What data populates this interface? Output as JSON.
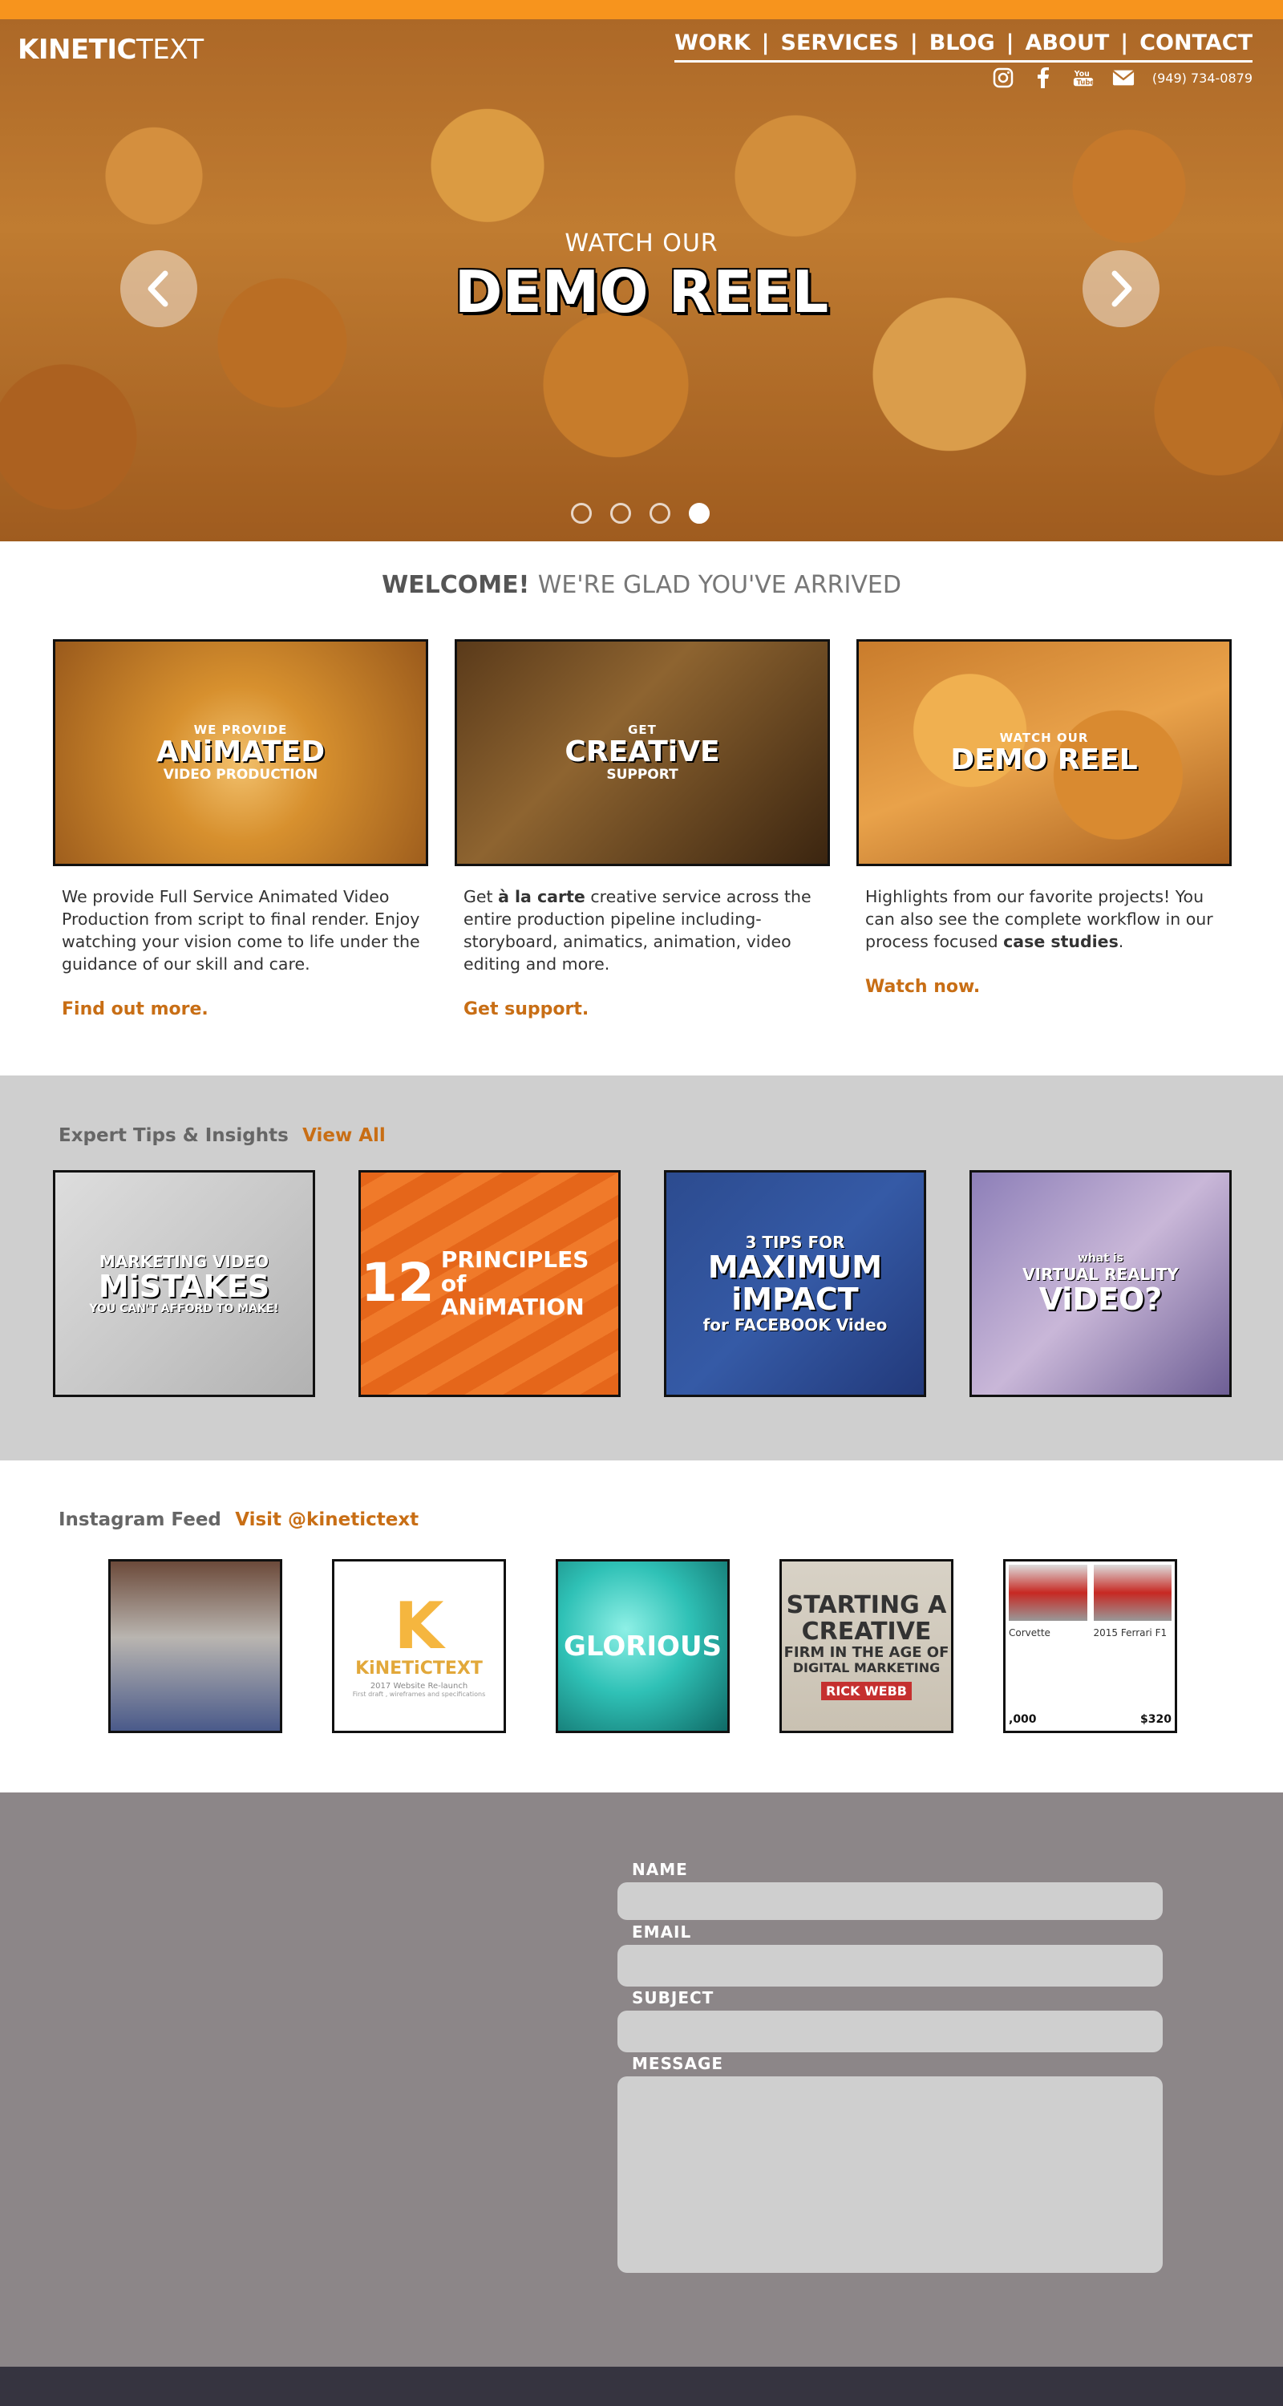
{
  "brand": {
    "logo_bold": "KINETIC",
    "logo_light": "TEXT",
    "accent": "#f7941d",
    "link_color": "#c86e15"
  },
  "nav": {
    "items": [
      "WORK",
      "SERVICES",
      "BLOG",
      "ABOUT",
      "CONTACT"
    ],
    "separator": "|",
    "phone": "(949) 734-0879",
    "social_icons": [
      "instagram-icon",
      "facebook-icon",
      "youtube-icon",
      "email-icon"
    ]
  },
  "hero": {
    "kicker": "WATCH OUR",
    "title": "DEMO REEL",
    "slides_total": 4,
    "active_slide": 4
  },
  "welcome": {
    "strong": "WELCOME!",
    "light": "WE'RE GLAD YOU'VE ARRIVED"
  },
  "cards": [
    {
      "img_top": "WE PROVIDE",
      "img_big": "ANiMATED",
      "img_sub": "VIDEO PRODUCTION",
      "text": "We provide Full Service Animated Video Production from script to final render. Enjoy watching your vision come to life under the guidance of our skill and care.",
      "link": "Find out more."
    },
    {
      "img_top": "GET",
      "img_big": "CREATiVE",
      "img_sub": "SUPPORT",
      "text_before": "Get ",
      "text_bold": "à la carte",
      "text_after": " creative service across the entire production pipeline including- storyboard, animatics, animation, video editing and more.",
      "link": "Get support."
    },
    {
      "img_top": "WATCH OUR",
      "img_big": "DEMO REEL",
      "img_sub": "",
      "text_before": "Highlights from our favorite projects! You can also see the complete workflow in our process focused ",
      "text_bold": "case studies",
      "text_after": ".",
      "link": "Watch now."
    }
  ],
  "tips": {
    "heading": "Expert Tips & Insights",
    "view_all": "View All",
    "tiles": [
      {
        "l1": "MARKETING VIDEO",
        "l2": "MiSTAKES",
        "l3": "YOU CAN'T AFFORD TO MAKE!"
      },
      {
        "num": "12",
        "w1": "PRINCIPLES of",
        "w2": "ANiMATION"
      },
      {
        "l1": "3 TIPS FOR",
        "l2a": "MAXIMUM",
        "l2b": "iMPACT",
        "l3": "for FACEBOOK Video"
      },
      {
        "l1": "what is",
        "l1b": "VIRTUAL REALITY",
        "l2": "ViDEO?"
      }
    ]
  },
  "instagram": {
    "heading": "Instagram Feed",
    "link": "Visit @kinetictext",
    "posts": [
      {
        "type": "photo"
      },
      {
        "k": "K",
        "name": "KiNETiCTEXT",
        "line1": "2017 Website Re-launch",
        "line2": "First draft , wireframes and specifications"
      },
      {
        "text": "GLORIOUS"
      },
      {
        "a": "STARTING A",
        "b": "CREATIVE",
        "c": "FIRM IN THE AGE OF",
        "d": "DIGITAL MARKETING",
        "e": "RICK WEBB"
      },
      {
        "left_caption": "Corvette",
        "right_caption": "2015 Ferrari F1",
        "left_price": ",000",
        "right_price": "$320"
      }
    ]
  },
  "contact": {
    "labels": {
      "name": "NAME",
      "email": "EMAIL",
      "subject": "SUBJECT",
      "message": "MESSAGE"
    },
    "values": {
      "name": "",
      "email": "",
      "subject": "",
      "message": ""
    }
  }
}
